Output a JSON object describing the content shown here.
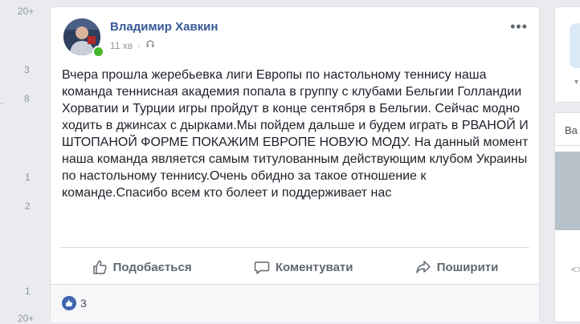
{
  "left_counts": [
    "20+",
    "3",
    "8",
    "1",
    "2",
    "1",
    "20+"
  ],
  "post": {
    "author": "Владимир Хавкин",
    "time": "11 хв",
    "text": "Вчера прошла жеребьевка лиги Европы по настольному теннису наша команда теннисная академия попала в группу с клубами Бельгии Голландии Хорватии и Турции игры пройдут в конце сентября в Бельгии. Сейчас модно ходить в джинсах с дырками.Мы пойдем дальше и будем играть в РВАНОЙ И ШТОПАНОЙ ФОРМЕ ПОКАЖИМ ЕВРОПЕ НОВУЮ МОДУ. На данный момент наша команда является самым титулованным действующим клубом Украины по настольному теннису.Очень обидно за такое отношение к команде.Спасибо всем кто болеет и поддерживает нас",
    "actions": {
      "like": "Подобається",
      "comment": "Коментувати",
      "share": "Поширити"
    },
    "likes_count": "3"
  },
  "right": {
    "card_title": "Ва",
    "small_text": "<>"
  },
  "colors": {
    "author_blue": "#365899",
    "like_blue": "#4267b2",
    "online_green": "#42b72a"
  }
}
